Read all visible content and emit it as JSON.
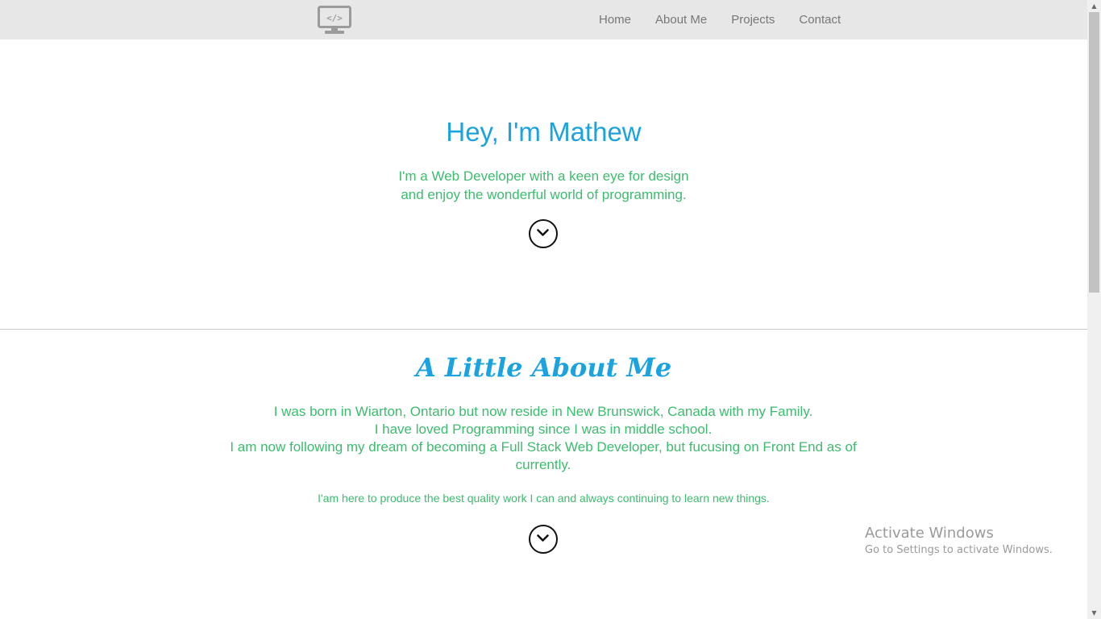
{
  "navbar": {
    "logo_icon": "monitor-code-icon",
    "links": [
      "Home",
      "About Me",
      "Projects",
      "Contact"
    ]
  },
  "hero": {
    "title": "Hey, I'm Mathew",
    "subtitle_lines": [
      "I'm a Web Developer with a keen eye for design",
      "and enjoy the wonderful world of programming."
    ],
    "scroll_icon": "chevron-down-circle-icon"
  },
  "about": {
    "title": "A Little About Me",
    "paragraph_lines": [
      "I was born in Wiarton, Ontario but now reside in New Brunswick, Canada with my Family.",
      "I have loved Programming since I was in middle school.",
      "I am now following my dream of becoming a Full Stack Web Developer, but fucusing on Front End as of currently."
    ],
    "note": "I'am here to produce the best quality work I can and always continuing to learn new things.",
    "scroll_icon": "chevron-down-circle-icon"
  },
  "watermark": {
    "title": "Activate Windows",
    "subtitle": "Go to Settings to activate Windows."
  },
  "colors": {
    "heading": "#1aa3df",
    "body_text": "#3dbb6e",
    "navbar_bg": "#e7e7e7",
    "nav_text": "#777777"
  }
}
